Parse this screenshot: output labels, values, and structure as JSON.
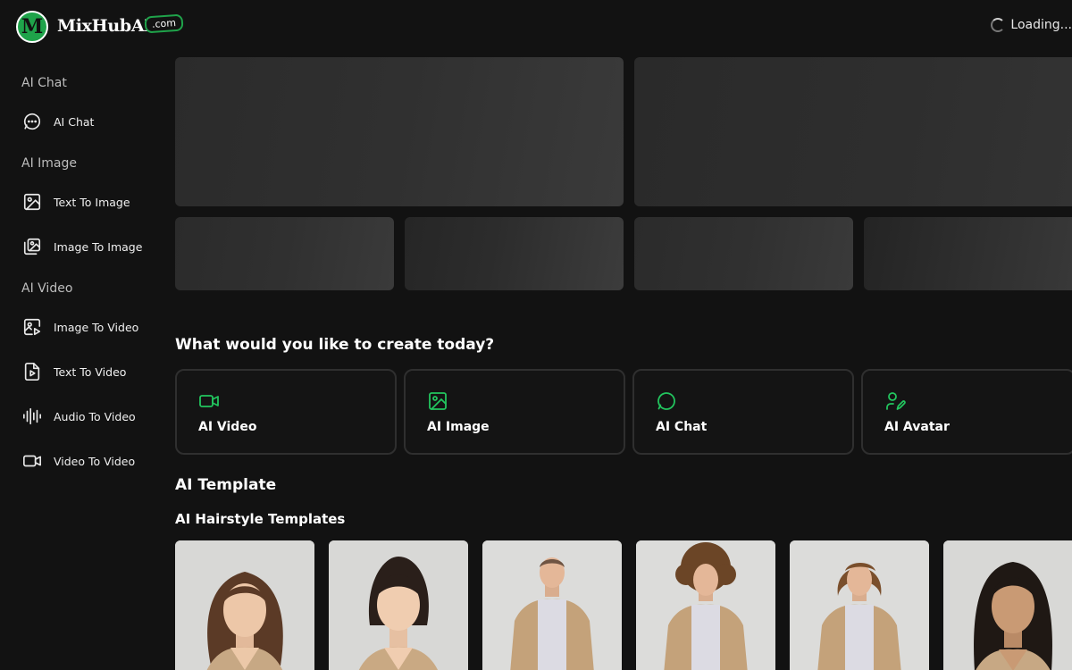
{
  "header": {
    "logo_letter": "M",
    "brand": "MixHubAI",
    "brand_badge": ".com",
    "loading_text": "Loading..."
  },
  "sidebar": {
    "sections": [
      {
        "title": "AI Chat",
        "items": [
          {
            "label": "AI Chat",
            "icon": "chat-bubble-icon"
          }
        ]
      },
      {
        "title": "AI Image",
        "items": [
          {
            "label": "Text To Image",
            "icon": "image-icon"
          },
          {
            "label": "Image To Image",
            "icon": "images-stack-icon"
          }
        ]
      },
      {
        "title": "AI Video",
        "items": [
          {
            "label": "Image To Video",
            "icon": "image-play-icon"
          },
          {
            "label": "Text To Video",
            "icon": "file-play-icon"
          },
          {
            "label": "Audio To Video",
            "icon": "audio-wave-icon"
          },
          {
            "label": "Video To Video",
            "icon": "video-camera-icon"
          }
        ]
      }
    ]
  },
  "create": {
    "heading": "What would you like to create today?",
    "cards": [
      {
        "label": "AI Video",
        "icon": "video-camera-icon"
      },
      {
        "label": "AI Image",
        "icon": "image-icon"
      },
      {
        "label": "AI Chat",
        "icon": "chat-bubble-icon"
      },
      {
        "label": "AI Avatar",
        "icon": "user-edit-icon"
      }
    ]
  },
  "templates": {
    "heading": "AI Template",
    "subheading": "AI Hairstyle Templates"
  },
  "colors": {
    "background": "#121212",
    "accent": "#22c55e",
    "brand_green": "#1fa34a",
    "card_border": "#2f2f2f"
  }
}
